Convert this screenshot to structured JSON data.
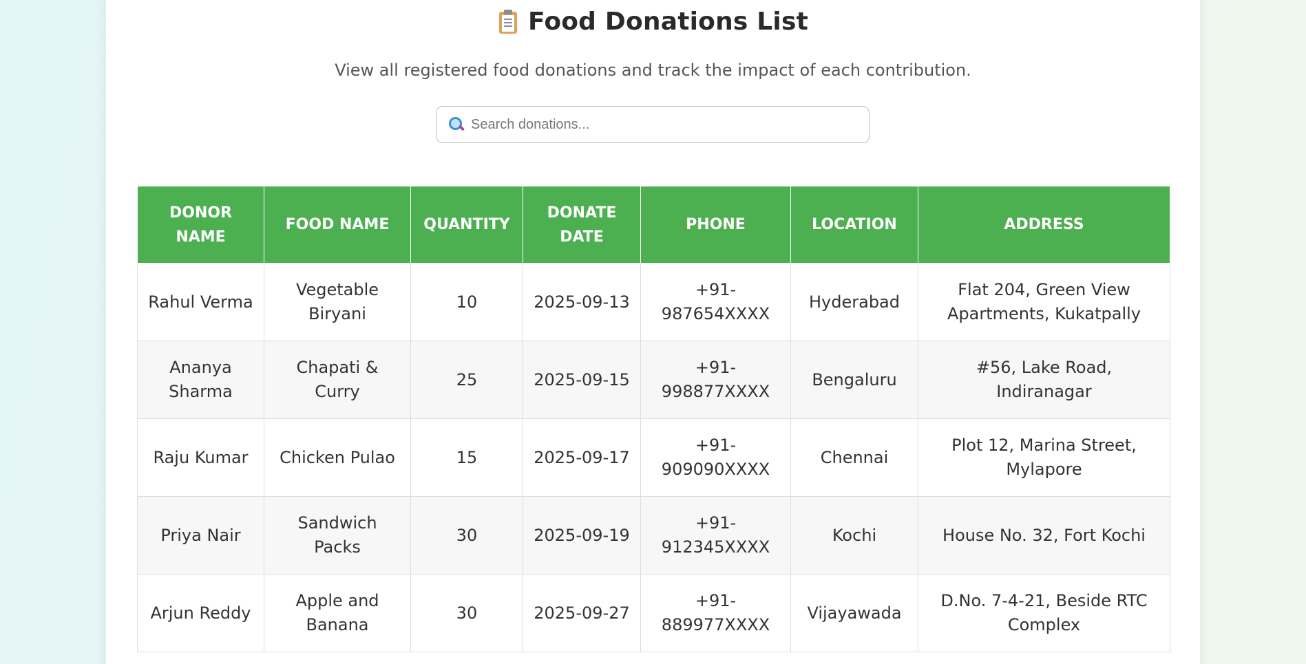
{
  "header": {
    "title": "Food Donations List",
    "title_icon": "clipboard-icon",
    "subtitle": "View all registered food donations and track the impact of each contribution."
  },
  "search": {
    "placeholder": "Search donations...",
    "value": "",
    "icon": "search-icon"
  },
  "colors": {
    "header_bg": "#4caf50",
    "row_alt_bg": "#f7f7f7"
  },
  "table": {
    "columns": [
      "Donor Name",
      "Food Name",
      "Quantity",
      "Donate Date",
      "Phone",
      "Location",
      "Address"
    ],
    "rows": [
      [
        "Rahul Verma",
        "Vegetable Biryani",
        "10",
        "2025-09-13",
        "+91-987654XXXX",
        "Hyderabad",
        "Flat 204, Green View Apartments, Kukatpally"
      ],
      [
        "Ananya Sharma",
        "Chapati & Curry",
        "25",
        "2025-09-15",
        "+91-998877XXXX",
        "Bengaluru",
        "#56, Lake Road, Indiranagar"
      ],
      [
        "Raju Kumar",
        "Chicken Pulao",
        "15",
        "2025-09-17",
        "+91-909090XXXX",
        "Chennai",
        "Plot 12, Marina Street, Mylapore"
      ],
      [
        "Priya Nair",
        "Sandwich Packs",
        "30",
        "2025-09-19",
        "+91-912345XXXX",
        "Kochi",
        "House No. 32, Fort Kochi"
      ],
      [
        "Arjun Reddy",
        "Apple and Banana",
        "30",
        "2025-09-27",
        "+91-889977XXXX",
        "Vijayawada",
        "D.No. 7-4-21, Beside RTC Complex"
      ]
    ]
  }
}
